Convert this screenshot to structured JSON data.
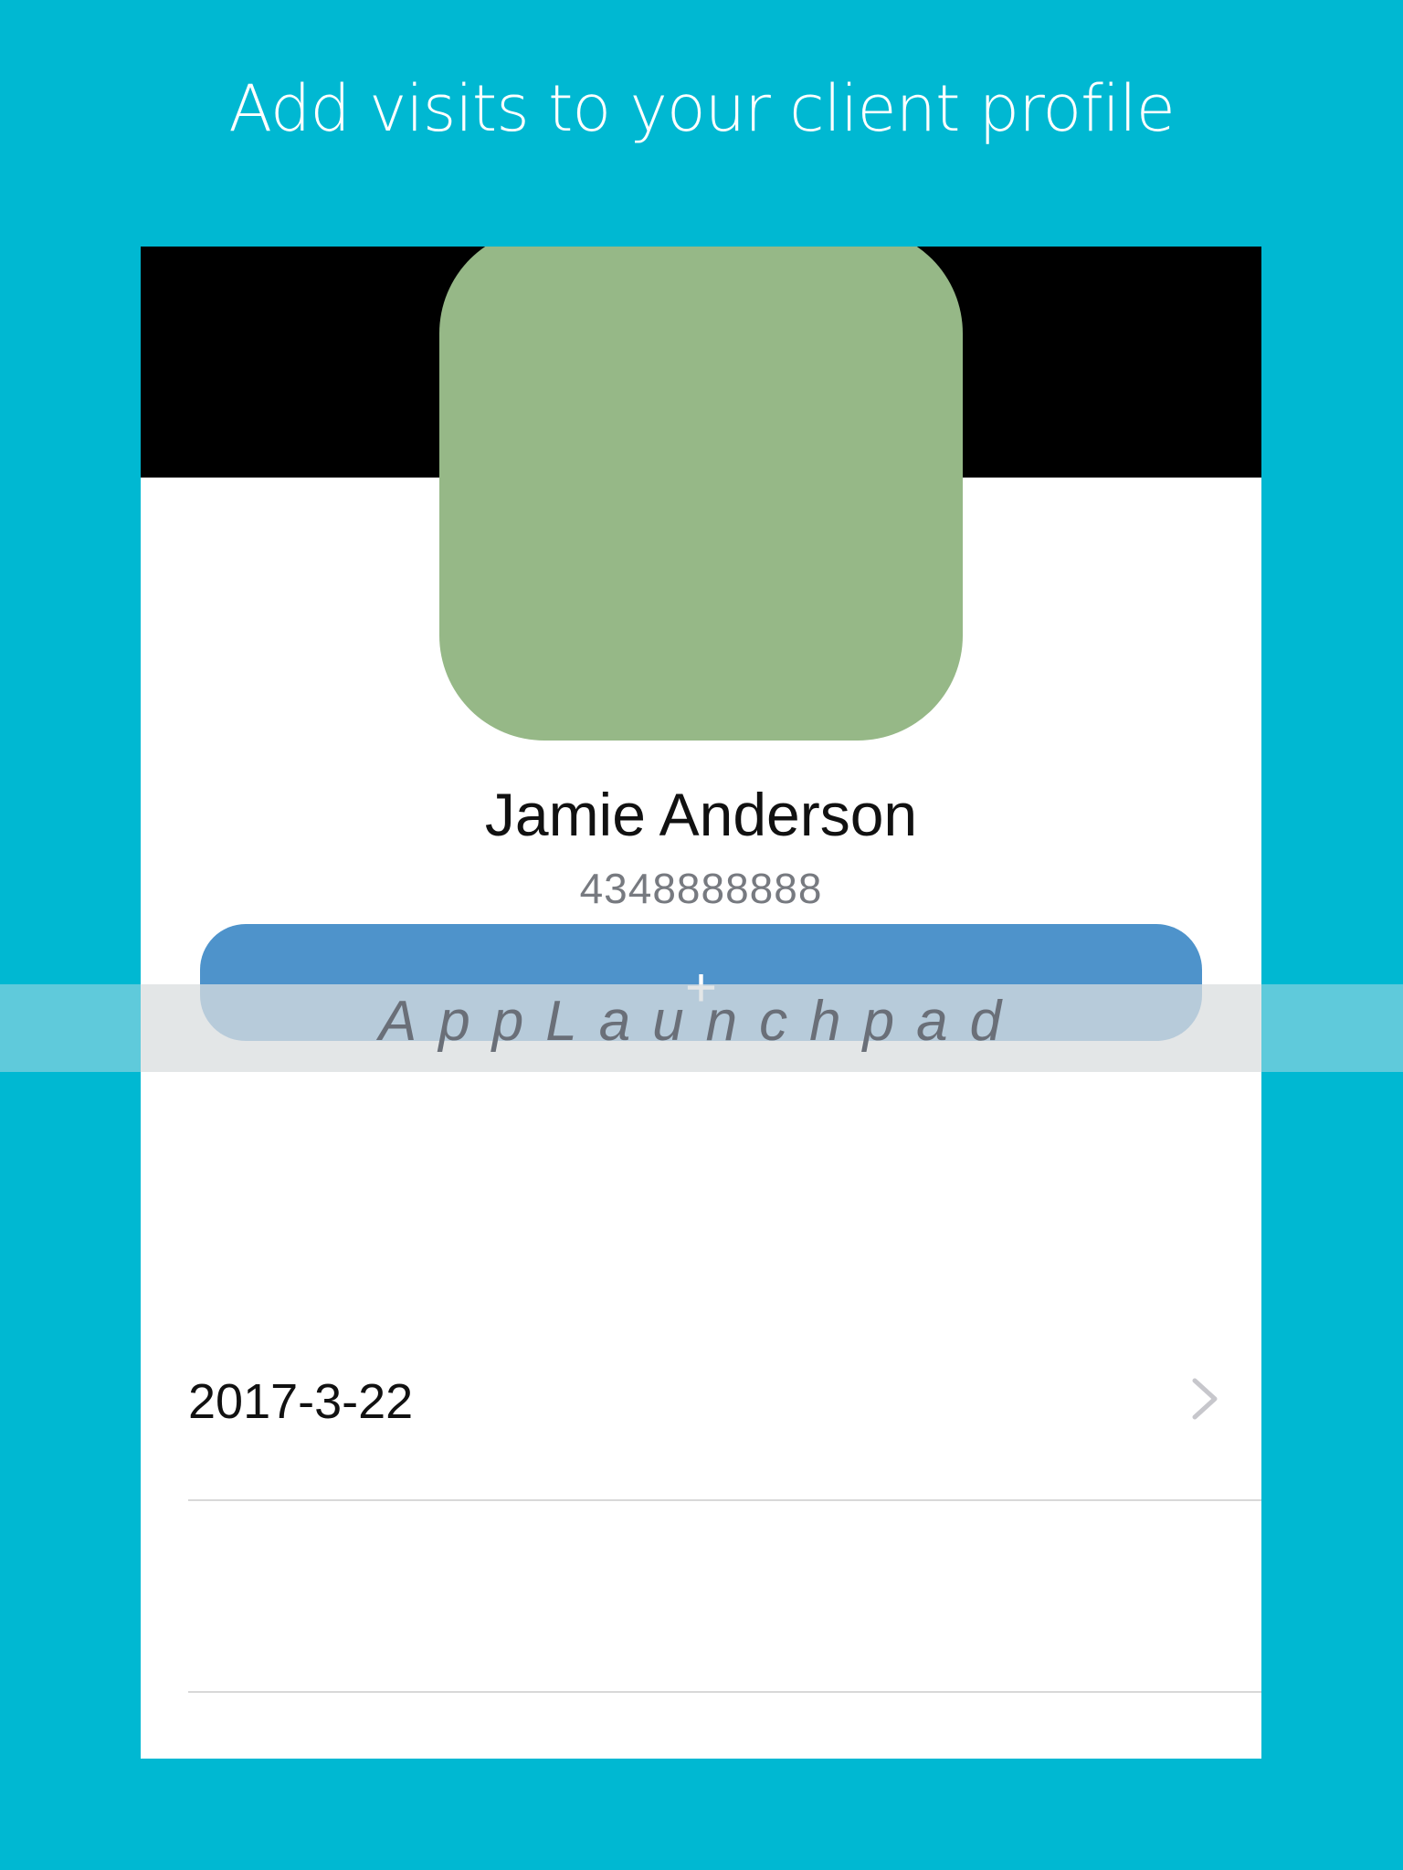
{
  "headline": "Add visits to your client profile",
  "client": {
    "name": "Jamie Anderson",
    "phone": "4348888888"
  },
  "add_visit_button": {
    "icon": "+"
  },
  "watermark": "AppLaunchpad",
  "visits": [
    {
      "date": "2017-3-22"
    },
    {
      "date": ""
    },
    {
      "date": ""
    }
  ],
  "colors": {
    "background": "#00b8d2",
    "avatar": "#96b887",
    "button": "#4e93cb",
    "header_band": "#000000"
  }
}
